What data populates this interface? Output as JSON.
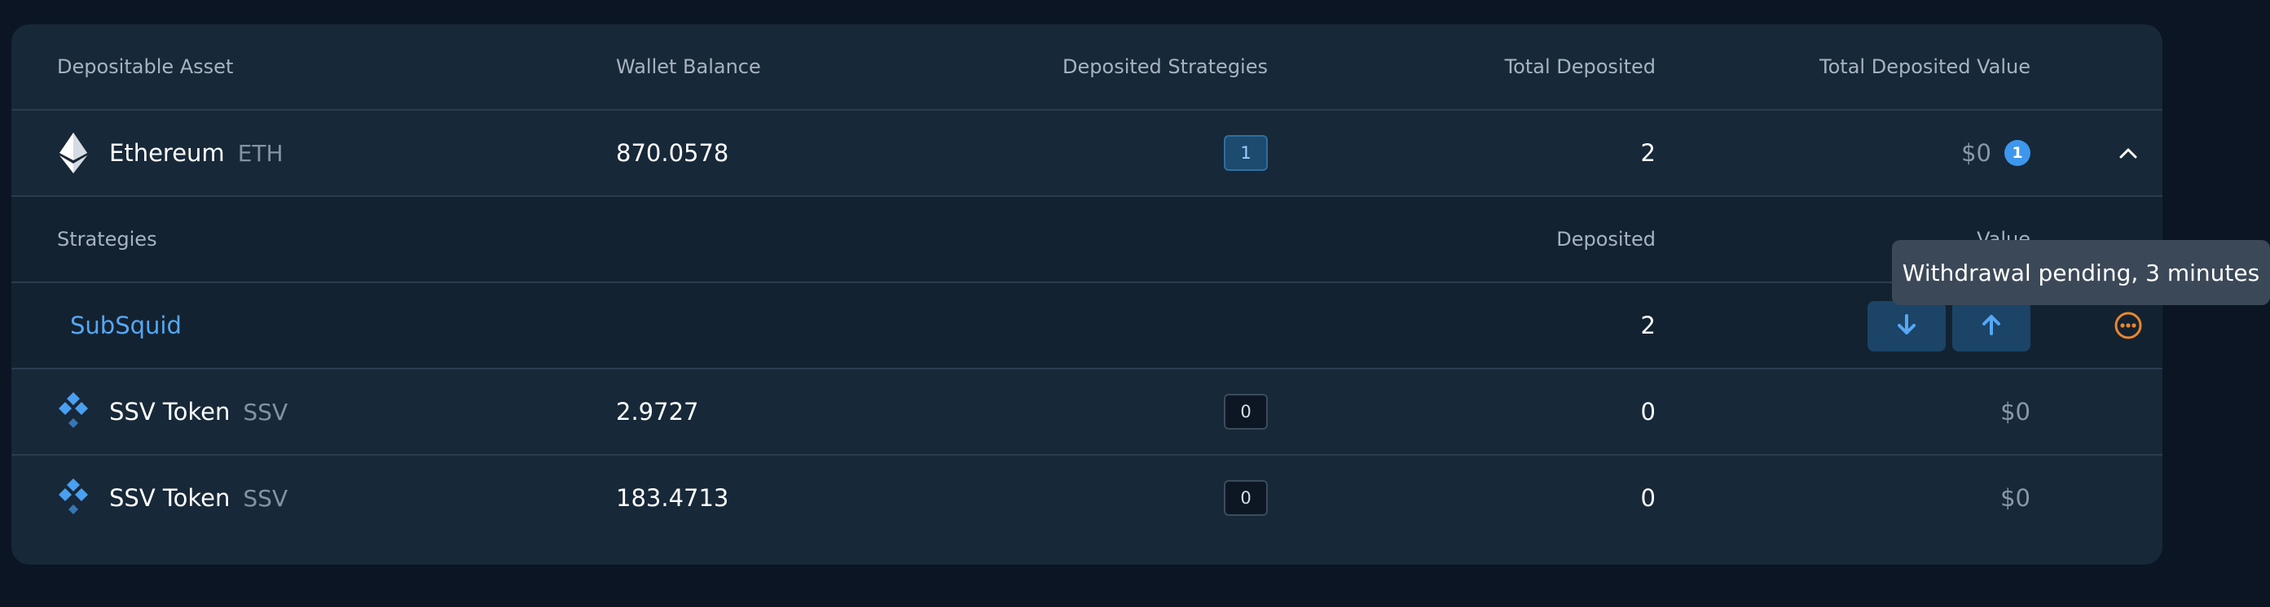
{
  "headers": {
    "asset": "Depositable Asset",
    "wallet_balance": "Wallet Balance",
    "deposited_strategies": "Deposited Strategies",
    "total_deposited": "Total Deposited",
    "total_deposited_value": "Total Deposited Value"
  },
  "assets": [
    {
      "name": "Ethereum",
      "symbol": "ETH",
      "icon": "ethereum-icon",
      "wallet_balance": "870.0578",
      "strategies_count": "1",
      "total_deposited": "2",
      "total_value": "$0",
      "pending_count": "1",
      "expanded": true
    },
    {
      "name": "SSV Token",
      "symbol": "SSV",
      "icon": "ssv-icon",
      "wallet_balance": "2.9727",
      "strategies_count": "0",
      "total_deposited": "0",
      "total_value": "$0"
    },
    {
      "name": "SSV Token",
      "symbol": "SSV",
      "icon": "ssv-icon",
      "wallet_balance": "183.4713",
      "strategies_count": "0",
      "total_deposited": "0",
      "total_value": "$0"
    }
  ],
  "strategies_panel": {
    "header_strategies": "Strategies",
    "header_deposited": "Deposited",
    "header_value": "Value",
    "items": [
      {
        "name": "SubSquid",
        "deposited": "2",
        "deposit_icon": "arrow-down-icon",
        "withdraw_icon": "arrow-up-icon",
        "pending_icon": "ellipsis-circle-icon"
      }
    ]
  },
  "tooltip": {
    "text": "Withdrawal pending, 3 minutes"
  },
  "colors": {
    "background": "#0b1523",
    "card": "#172838",
    "accent": "#56a7f4",
    "pending": "#e8872f"
  }
}
